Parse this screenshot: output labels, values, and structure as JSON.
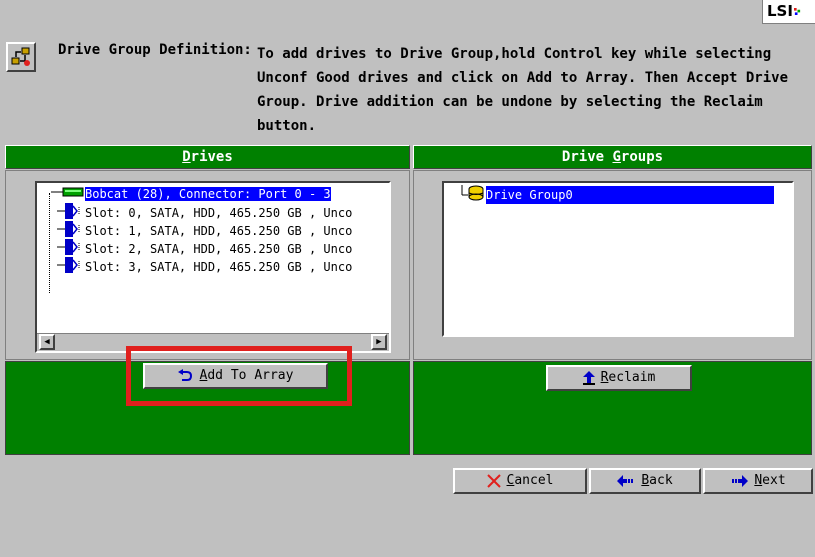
{
  "logo": {
    "text": "LSI"
  },
  "definition": {
    "label": "Drive Group Definition:",
    "line1": "To add drives to Drive Group,hold Control key while selecting",
    "rest": "Unconf Good drives and click on Add to Array. Then Accept Drive\nGroup. Drive addition can be undone by selecting the Reclaim\nbutton."
  },
  "drives_panel": {
    "header_prefix": "",
    "header_hotkey": "D",
    "header_rest": "rives",
    "controller": "Bobcat (28), Connector: Port 0 - 3",
    "slots": [
      "Slot: 0, SATA, HDD, 465.250 GB , Unco",
      "Slot: 1, SATA, HDD, 465.250 GB , Unco",
      "Slot: 2, SATA, HDD, 465.250 GB , Unco",
      "Slot: 3, SATA, HDD, 465.250 GB , Unco"
    ]
  },
  "groups_panel": {
    "header_prefix": "Drive ",
    "header_hotkey": "G",
    "header_rest": "roups",
    "groups": [
      "Drive Group0"
    ]
  },
  "buttons": {
    "add_hotkey": "A",
    "add_rest": "dd To Array",
    "reclaim_hotkey": "R",
    "reclaim_rest": "eclaim",
    "cancel_hotkey": "C",
    "cancel_rest": "ancel",
    "back_hotkey": "B",
    "back_rest": "ack",
    "next_hotkey": "N",
    "next_rest": "ext"
  },
  "icons": {
    "definition": "drive-group-definition-icon",
    "controller": "controller-icon",
    "drive": "physical-drive-icon",
    "group": "drive-group-icon",
    "add": "undo-arrow-icon",
    "reclaim": "up-arrow-icon",
    "cancel": "x-icon",
    "back": "left-arrow-icon",
    "next": "right-arrow-icon"
  },
  "colors": {
    "panel_header": "#008000",
    "selection": "#0000ff",
    "highlight": "#e0201d",
    "background": "#c0c0c0"
  }
}
